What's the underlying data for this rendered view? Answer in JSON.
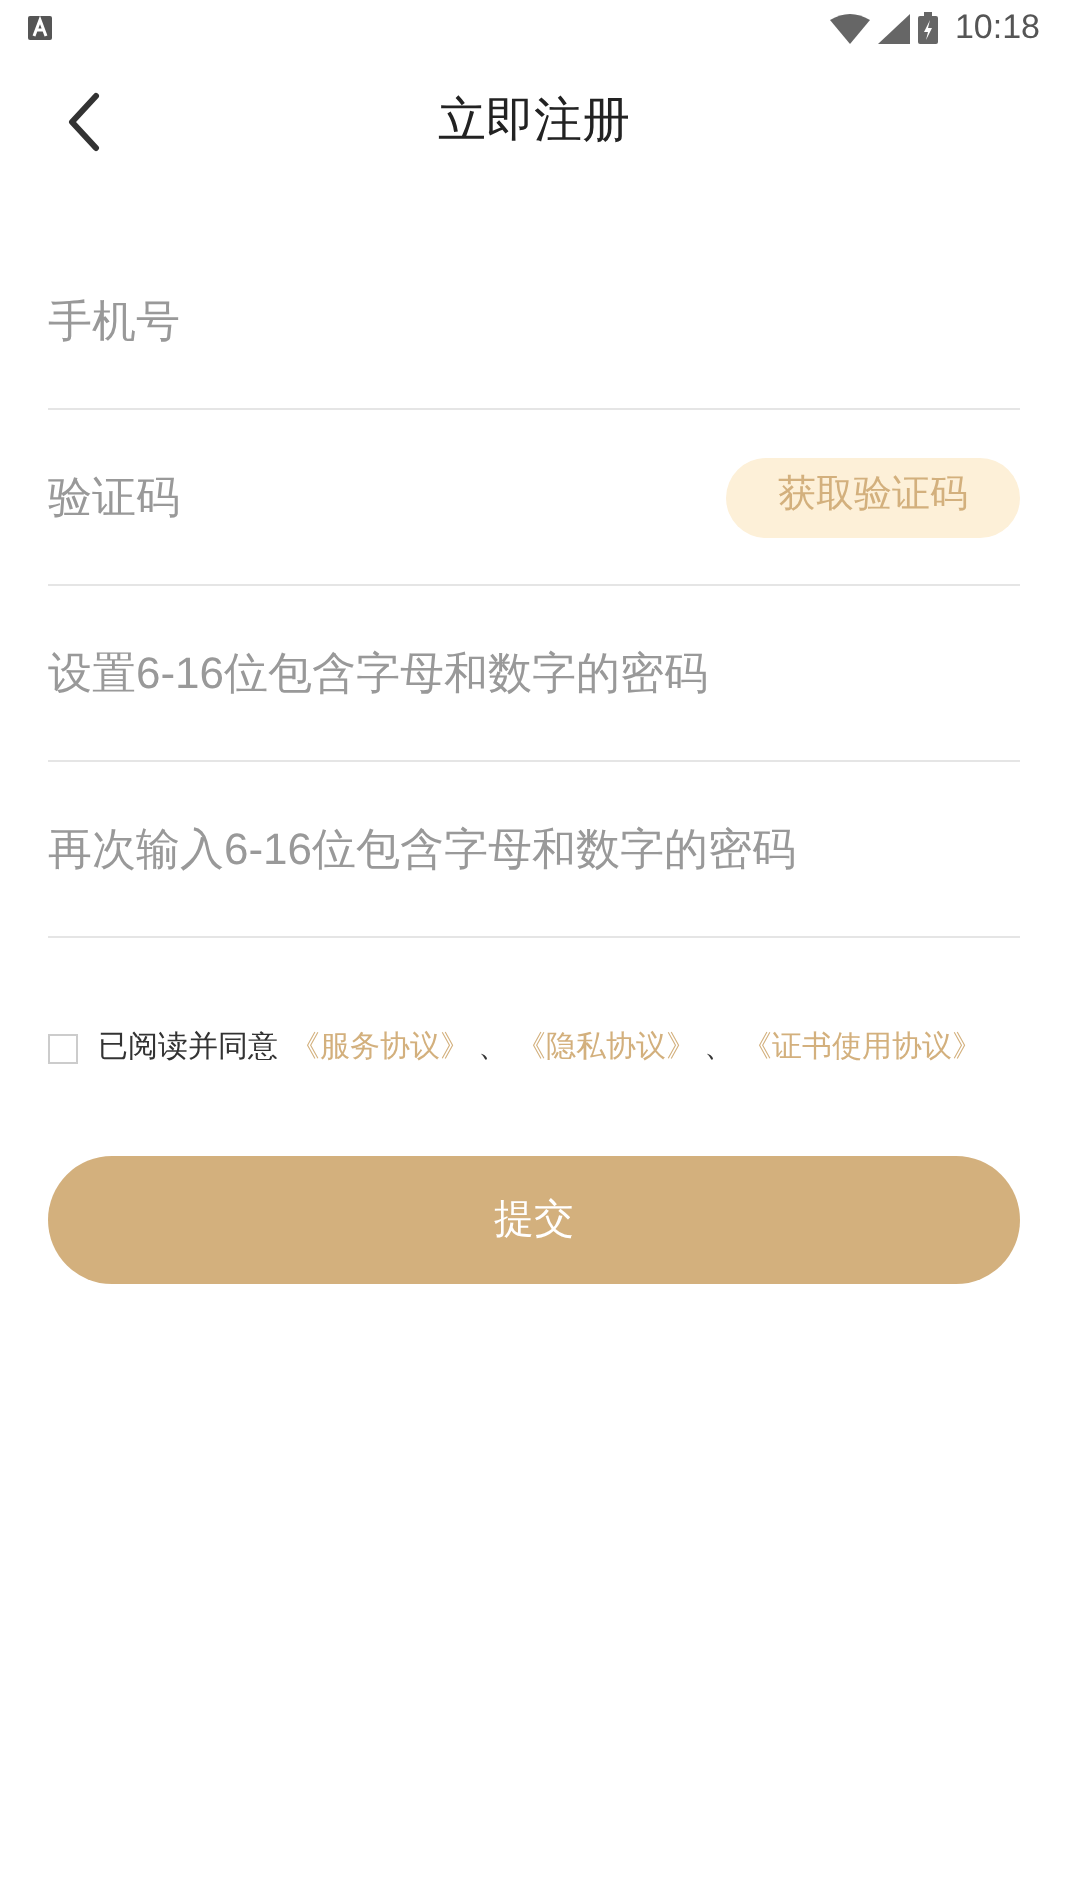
{
  "status_bar": {
    "time": "10:18"
  },
  "header": {
    "title": "立即注册"
  },
  "fields": [
    {
      "kind": "text",
      "placeholder": "手机号"
    },
    {
      "kind": "code",
      "placeholder": "验证码",
      "button": "获取验证码"
    },
    {
      "kind": "text",
      "placeholder": "设置6-16位包含字母和数字的密码"
    },
    {
      "kind": "text",
      "placeholder": "再次输入6-16位包含字母和数字的密码"
    }
  ],
  "agreement": {
    "checked": false,
    "text": "已阅读并同意",
    "parts": [
      {
        "kind": "link",
        "text": "《服务协议》"
      },
      {
        "kind": "sep",
        "text": "、"
      },
      {
        "kind": "link",
        "text": "《隐私协议》"
      },
      {
        "kind": "sep",
        "text": "、"
      },
      {
        "kind": "link",
        "text": "《证书使用协议》"
      }
    ]
  },
  "submit": "提交"
}
